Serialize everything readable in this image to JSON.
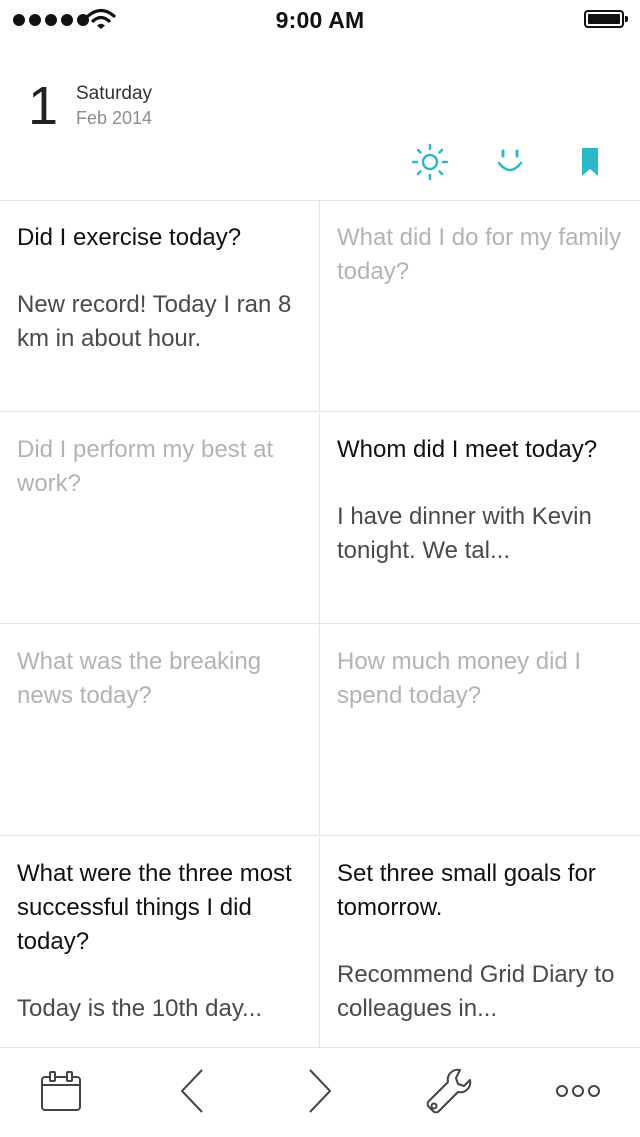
{
  "status_bar": {
    "time": "9:00 AM",
    "signal_bars": 5,
    "battery_level": 1.0
  },
  "header": {
    "day": "1",
    "weekday": "Saturday",
    "month_year": "Feb 2014",
    "icons": [
      "sun-icon",
      "smile-icon",
      "bookmark-icon"
    ]
  },
  "accent_color": "#2bb8c9",
  "grid": {
    "cells": [
      {
        "question": "Did I exercise today?",
        "answer": "New record! Today I ran 8 km in about hour."
      },
      {
        "question": "What did I do for my family today?",
        "answer": ""
      },
      {
        "question": "Did I perform my best at work?",
        "answer": ""
      },
      {
        "question": "Whom did I meet today?",
        "answer": "I have dinner with Kevin tonight.  We tal..."
      },
      {
        "question": "What was the breaking news today?",
        "answer": ""
      },
      {
        "question": "How much money did I spend today?",
        "answer": ""
      },
      {
        "question": "What were the three most successful things I did today?",
        "answer": "Today is the 10th day..."
      },
      {
        "question": "Set three small goals for tomorrow.",
        "answer": "Recommend Grid Diary to colleagues in..."
      }
    ]
  },
  "toolbar": {
    "icons": [
      "calendar-icon",
      "chevron-left-icon",
      "chevron-right-icon",
      "wrench-icon",
      "more-icon"
    ]
  }
}
